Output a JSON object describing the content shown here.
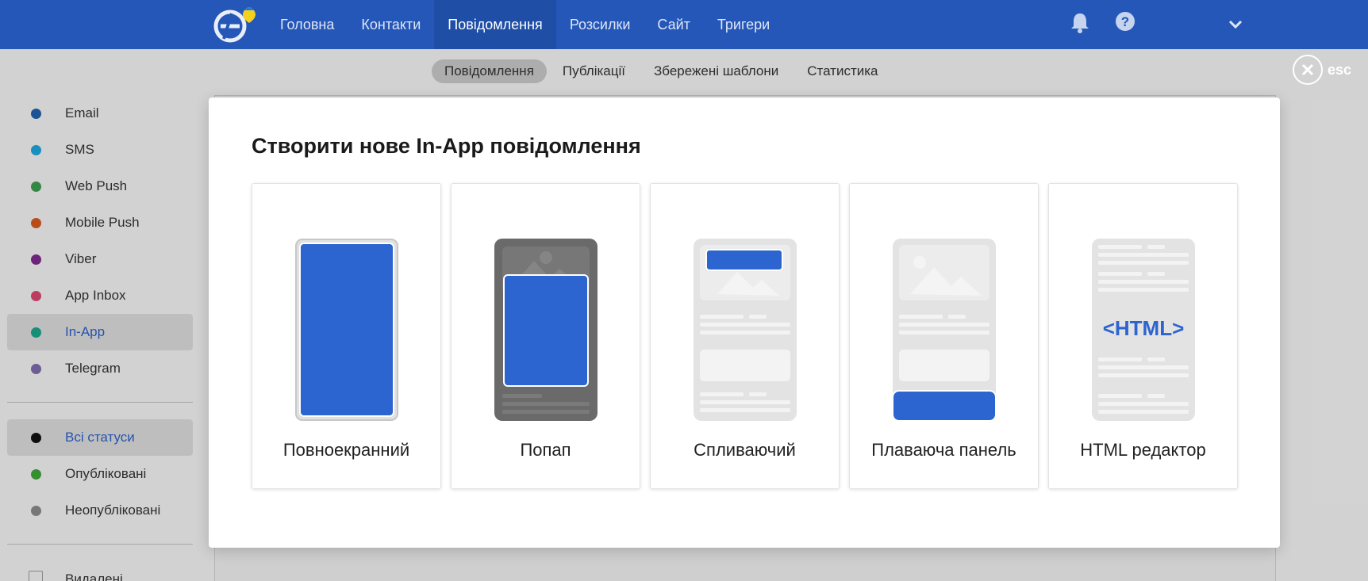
{
  "nav": {
    "items": [
      "Головна",
      "Контакти",
      "Повідомлення",
      "Розсилки",
      "Сайт",
      "Тригери"
    ],
    "active": "Повідомлення",
    "logo_icon": "logo-e-icon",
    "bell_icon": "bell-icon",
    "help_icon": "help-icon",
    "menu_icon": "chevron-down-icon"
  },
  "subnav": {
    "items": [
      "Повідомлення",
      "Публікації",
      "Збережені шаблони",
      "Статистика"
    ],
    "active": "Повідомлення"
  },
  "sidebar": {
    "channels": [
      {
        "label": "Email",
        "color": "#1f5fa8"
      },
      {
        "label": "SMS",
        "color": "#1ca3d9"
      },
      {
        "label": "Web Push",
        "color": "#3d9a4f"
      },
      {
        "label": "Mobile Push",
        "color": "#d2581f"
      },
      {
        "label": "Viber",
        "color": "#7d2a8c"
      },
      {
        "label": "App Inbox",
        "color": "#d74670"
      },
      {
        "label": "In-App",
        "color": "#1ba288",
        "active": true
      },
      {
        "label": "Telegram",
        "color": "#7b6aa8"
      }
    ],
    "statuses": [
      {
        "label": "Всі статуси",
        "color": "#111111",
        "active": true
      },
      {
        "label": "Опубліковані",
        "color": "#3fa237"
      },
      {
        "label": "Неопубліковані",
        "color": "#888888"
      }
    ],
    "deleted_label": "Видалені"
  },
  "close": {
    "label": "esc",
    "icon": "close-icon"
  },
  "modal": {
    "title": "Створити нове In-App повідомлення",
    "cards": [
      {
        "label": "Повноекранний",
        "icon": "fullscreen-phone-icon"
      },
      {
        "label": "Попап",
        "icon": "popup-phone-icon"
      },
      {
        "label": "Спливаючий",
        "icon": "slide-in-phone-icon"
      },
      {
        "label": "Плаваюча панель",
        "icon": "floating-panel-phone-icon"
      },
      {
        "label": "HTML редактор",
        "icon": "html-editor-phone-icon",
        "badge": "<HTML>"
      }
    ]
  },
  "colors": {
    "brand": "#2457b8",
    "accent": "#2c64d0"
  }
}
